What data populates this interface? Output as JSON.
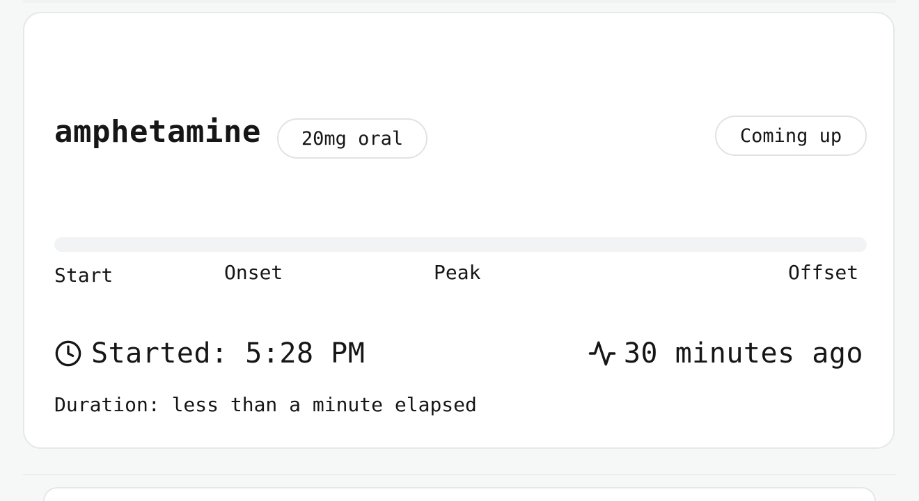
{
  "dose_card": {
    "substance": "amphetamine",
    "dose_badge": "20mg oral",
    "status_badge": "Coming up",
    "progress": {
      "fraction": 0,
      "phases": [
        "Start",
        "Onset",
        "Peak",
        "Offset"
      ]
    },
    "started": "Started: 5:28 PM",
    "elapsed": "30 minutes ago",
    "duration": "Duration: less than a minute elapsed"
  },
  "icons": {
    "started": "clock-icon",
    "elapsed": "activity-icon"
  },
  "colors": {
    "background": "#f6f7f7",
    "card": "#ffffff",
    "border": "#e6e7e9",
    "track": "#f2f3f4",
    "text": "#161616"
  }
}
